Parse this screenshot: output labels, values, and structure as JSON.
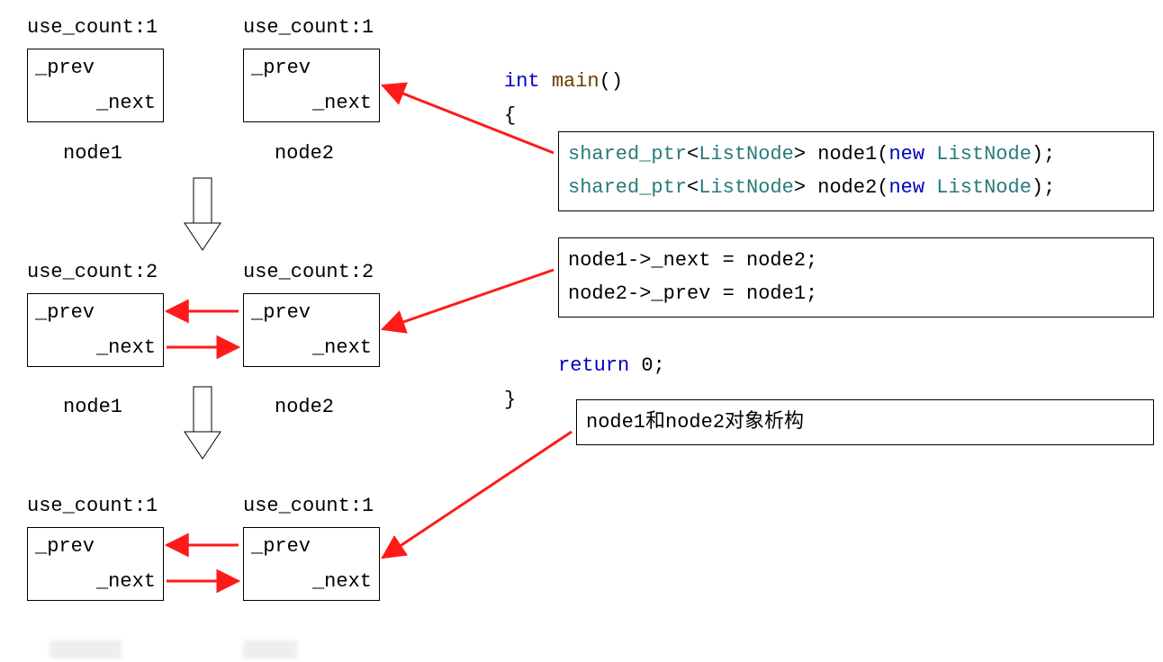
{
  "stage1": {
    "uc1": "use_count:1",
    "uc2": "use_count:1",
    "n1": "node1",
    "n2": "node2"
  },
  "stage2": {
    "uc1": "use_count:2",
    "uc2": "use_count:2",
    "n1": "node1",
    "n2": "node2"
  },
  "stage3": {
    "uc1": "use_count:1",
    "uc2": "use_count:1"
  },
  "box": {
    "prev": "_prev",
    "next": "_next"
  },
  "code": {
    "int": "int",
    "main": "main",
    "parens": "()",
    "lbrace": "{",
    "rbrace": "}",
    "shared_ptr": "shared_ptr",
    "lt": "<",
    "gt": ">",
    "ListNode": "ListNode",
    "node1": "node1",
    "node2": "node2",
    "new": "new",
    "lp": "(",
    "rp": ")",
    "semi": ";",
    "assign_next": "node1->_next = node2;",
    "assign_prev": "node2->_prev = node1;",
    "return": "return",
    "zero": " 0;",
    "destruct": "node1和node2对象析构"
  }
}
